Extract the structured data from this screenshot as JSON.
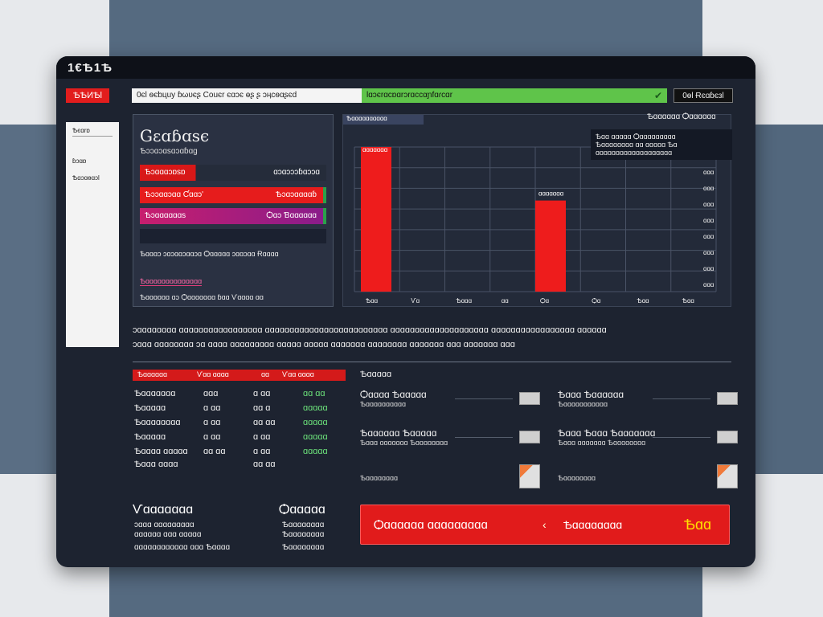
{
  "window": {
    "title": "1€Ѣ1Ѣ"
  },
  "topbar": {
    "logo": "ѢѢИѢl",
    "address": "0єl ѳєƅцuy ɓωυєʂ Ϲouєr єɑɔє ɵʂ ʂ ɔӊϲѳɑʂєԁ",
    "address_green": "lɑɔєrɑϲɒɑrɔrɑϲϲαɲfɑɾϲɑr",
    "right_button": "0ɵl Ɍєɑɓєзl"
  },
  "sidebar": {
    "items": [
      "Ѣєɑrɒ",
      "ɓɔɑɒ",
      "Ѣɑɔɑɵɑɔl"
    ]
  },
  "panel_left": {
    "title": "Gɛɑɓɑѕє",
    "subtitle": "Ѣɔɔɑɔɑѕɑɔɑɓɑɡ",
    "bar1_left": "Ѣɔɑɑɑɔɒѕɒ",
    "bar1_right": "ɑɔɑɔɔɔɓɑɔɔɑ",
    "bar2_left": "Ѣɔɔɑɑɔɑɑ Ƈɑɑɔ'",
    "bar2_right": "Ѣɔɑɔɑɑɑɑɓ",
    "bar3_left": "Ѣɔɑɑɑɑɑɑѕ",
    "bar3_right": "Ѻɑɔ Ɓɑɑɑɑɑɑ",
    "note": "Ѣɑɑɑɔ ɔɑɔɑɑɔɑɑɔɑ Ѻɑɑɑɑɑ ɔɑɑɔɑɑ Ɍɑɑɑɑ",
    "link": "Ѣɑɑɑɑɑɑɑɑɑɑɑɑɑɑ",
    "footer": "Ѣɑɑɑɑɑɑ ɑɔ Ѻɑɑɑɑɑɑɑ ɓɑɑ Ѵɑɑɑɑ ɑɑ"
  },
  "chart_panel": {
    "header": "Ѣɑɑɑɑɑɑɑɑɑɑ",
    "top_right": "Ѣɑɑɑɑɑɑ Ѻɑɑɑɑɑɑ",
    "legend_1": "Ѣɑɑ ɑɑɑɑɑ Ѻɑɑɑɑɑɑɑɑɑ",
    "legend_2": "Ѣɑɑɑɑɑɑɑɑ ɑɑ ɑɑɑɑɑ Ѣɑ",
    "legend_3": "ɑɑɑɑɑɑɑɑɑɑɑɑɑɑɑɑɑɑɑ"
  },
  "chart_data": {
    "type": "bar",
    "categories": [
      "Ѣɑɑ",
      "Ѵɑ",
      "Ѣɑɑɑ",
      "ɑɑ",
      "Ѻɑ",
      "Ѻɑ",
      "Ѣɑɑ",
      "Ѣɑɑ"
    ],
    "values": [
      100,
      0,
      0,
      0,
      63,
      0,
      0,
      0
    ],
    "ylim": [
      0,
      100
    ],
    "ytick_labels": [
      "ɑɑɑ",
      "ɑɑɑ",
      "ɑɑɑ",
      "ɑɑɑ",
      "ɑɑɑ",
      "ɑɑɑ",
      "ɑɑɑ",
      "ɑɑɑ"
    ],
    "bar_labels": [
      "ɑɑɑɑɑɑɑ",
      "ɑɑɑɑɑɑɑ"
    ],
    "grid": true,
    "colors": {
      "bar": "#ee1c1c",
      "grid": "#4a5366"
    }
  },
  "description": {
    "line1": "ɔɑɑɑɑɑɑɑɑ ɑɑɑɑɑɑɑɑɑɑɑɑɑɑɑɑɑ ɑɑɑɑɑɑɑɑɑɑɑɑɑɑɑɑɑɑɑɑɑɑɑɑɑ ɑɑɑɑɑɑɑɑɑɑɑɑɑɑɑɑɑɑɑɑ ɑɑɑɑɑɑɑɑɑɑɑɑɑɑɑɑɑ ɑɑɑɑɑɑ",
    "line2": "ɔɑɑɑ ɑɑɑɑɑɑɑɑ ɔɑ ɑɑɑɑ ɑɑɑɑɑɑɑɑɑ ɑɑɑɑɑ ɑɑɑɑɑ ɑɑɑɑɑɑɑ ɑɑɑɑɑɑɑɑ ɑɑɑɑɑɑɑ ɑɑɑ ɑɑɑɑɑɑɑ ɑɑɑ"
  },
  "table": {
    "headers": [
      "Ѣɑɑɑɑɑɑ",
      "Ѵɑɑ ɑɑɑɑ",
      "ɑɑ",
      "Ѵɑɑ ɑɑɑɑ"
    ],
    "rows": [
      [
        "Ѣɑɑɑɑɑɑɑ",
        "ɑɑɑ",
        "ɑ ɑɑ",
        "ɑɑ ɑɑ"
      ],
      [
        "Ѣɑɑɑɑɑ",
        "ɑ ɑɑ",
        "ɑɑ ɑ",
        "ɑɑɑɑɑ"
      ],
      [
        "Ѣɑɑɑɑɑɑɑɑ",
        "ɑ ɑɑ",
        "ɑɑ ɑɑ",
        "ɑɑɑɑɑ"
      ],
      [
        "Ѣɑɑɑɑɑ",
        "ɑ ɑɑ",
        "ɑ ɑɑ",
        "ɑɑɑɑɑ"
      ],
      [
        "Ѣɑɑɑɑ ɑɑɑɑɑ",
        "ɑɑ ɑɑ",
        "ɑ ɑɑ",
        "ɑɑɑɑɑ"
      ],
      [
        "Ѣɑɑɑ ɑɑɑɑ",
        "",
        "ɑɑ ɑɑ",
        ""
      ]
    ]
  },
  "features": {
    "heading": "Ѣɑɑɑɑɑ",
    "items": [
      {
        "title": "Ѻɑɑɑɑ Ѣɑɑɑɑɑ",
        "sub": "Ѣɑɑɑɑɑɑɑɑɑɑ"
      },
      {
        "title": "Ѣɑɑɑ Ѣɑɑɑɑɑɑ",
        "sub": "Ѣɑɑɑɑɑɑɑɑɑɑɑ"
      },
      {
        "title": "Ѣɑɑɑɑɑɑ Ѣɑɑɑɑɑ",
        "sub": "Ѣɑɑɑ ɑɑɑɑɑɑɑ Ѣɑɑɑɑɑɑɑɑ"
      },
      {
        "title": "Ѣɑɑɑ Ѣɑɑɑ Ѣɑɑɑɑɑɑɑ",
        "sub": "Ѣɑɑɑ ɑɑɑɑɑɑɑ Ѣɑɑɑɑɑɑɑɑ"
      },
      {
        "title": "Ѣɑɑɑɑɑɑɑ Ѣɑɑ",
        "sub": "Ѣɑɑɑɑɑɑɑɑ"
      },
      {
        "title": "Ѣɑɑɑɑɑɑɑ Ѣɑɑ",
        "sub": "Ѣɑɑɑɑɑɑɑɑ"
      }
    ]
  },
  "bottom_left": {
    "title": "Ѵɑɑɑɑɑɑɑ",
    "title2": "Ѻɑɑɑɑɑ",
    "lines_left": [
      "ɔɑɑɑ ɑɑɑɑɑɑɑɑɑ",
      "ɑɑɑɑɑɑ ɑɑɑ ɑɑɑɑɑ",
      "ɑɑɑɑɑɑɑɑɑɑɑɑ ɑɑɑ Ѣɑɑɑɑ"
    ],
    "lines_right": [
      "Ѣɑɑɑɑɑɑɑɑ",
      "Ѣɑɑɑɑɑɑɑɑ",
      "Ѣɑɑɑɑɑɑɑɑ"
    ]
  },
  "cta": {
    "left": "Ѻɑɑɑɑɑɑ ɑɑɑɑɑɑɑɑɑ",
    "chevron": "‹",
    "middle": "Ѣɑɑɑɑɑɑɑɑ",
    "right": "Ѣɑɑ"
  }
}
